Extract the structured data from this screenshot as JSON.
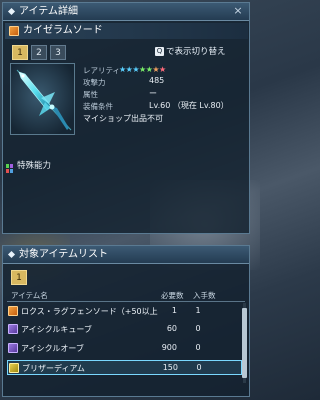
{
  "item_detail": {
    "title": "アイテム詳細",
    "close": "×",
    "item_name": "カイゼラムソード",
    "tabs": [
      "1",
      "2",
      "3"
    ],
    "toggle_key": "Q",
    "toggle_label": "で表示切り替え",
    "rarity_label": "レアリティ",
    "rarity_stars": 7,
    "attack_label": "攻撃力",
    "attack_value": "485",
    "element_label": "属性",
    "element_value": "ー",
    "requirement_label": "装備条件",
    "requirement_value": "Lv.60 （現在 Lv.80）",
    "shop_note": "マイショップ出品不可",
    "special_ability_label": "特殊能力"
  },
  "target_list": {
    "title": "対象アイテムリスト",
    "tab": "1",
    "col_item_name": "アイテム名",
    "col_required": "必要数",
    "col_owned": "入手数",
    "rows": [
      {
        "name": "ロクス・ラグフェンソード（+50以上",
        "required": "1",
        "owned": "1",
        "icon": "orange-weapon-icon"
      },
      {
        "name": "アイシクルキューブ",
        "required": "60",
        "owned": "0",
        "icon": "purple-material-icon"
      },
      {
        "name": "アイシクルオーブ",
        "required": "900",
        "owned": "0",
        "icon": "purple-material-icon"
      },
      {
        "name": "ブリザーディアム",
        "required": "150",
        "owned": "0",
        "icon": "yellow-material-icon"
      }
    ]
  }
}
